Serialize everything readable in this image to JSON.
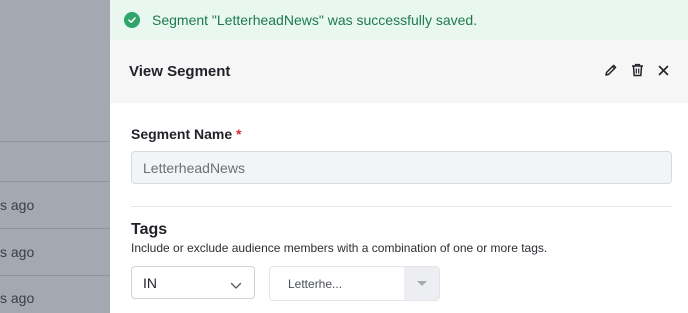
{
  "background": {
    "rows": [
      "s ago",
      "s ago",
      "s ago"
    ]
  },
  "toast": {
    "message": "Segment \"LetterheadNews\" was successfully saved.",
    "icon": "check-circle-icon",
    "color": "#2fa56a"
  },
  "panel": {
    "title": "View Segment",
    "actions": [
      "edit-icon",
      "trash-icon",
      "close-icon"
    ]
  },
  "segment_name": {
    "label": "Segment Name",
    "required_marker": "*",
    "value": "LetterheadNews"
  },
  "tags": {
    "title": "Tags",
    "description": "Include or exclude audience members with a combination of one or more tags.",
    "operator_value": "IN",
    "tag_value": "Letterhe..."
  }
}
